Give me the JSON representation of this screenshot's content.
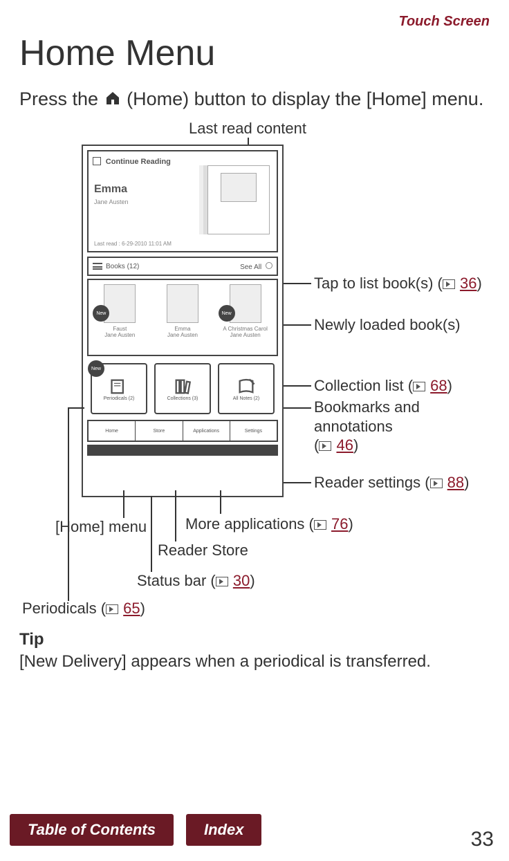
{
  "header": {
    "section": "Touch Screen"
  },
  "title": "Home Menu",
  "intro": {
    "prefix": "Press the ",
    "suffix": " (Home) button to display the [Home] menu."
  },
  "screenshot": {
    "continue_label": "Continue Reading",
    "book_title": "Emma",
    "book_author": "Jane Austen",
    "last_read": "Last read : 6-29-2010 11:01 AM",
    "books_bar_left": "Books (12)",
    "books_bar_right": "See All",
    "new_badge": "New",
    "shelf": [
      {
        "title": "Faust",
        "author": "Jane Austen"
      },
      {
        "title": "Emma",
        "author": "Jane Austen"
      },
      {
        "title": "A Christmas Carol",
        "author": "Jane Austen"
      }
    ],
    "tiles": {
      "periodicals": "Periodicals (2)",
      "collections": "Collections (3)",
      "all_notes": "All Notes (2)"
    },
    "tabs": {
      "home": "Home",
      "store": "Store",
      "apps": "Applications",
      "settings": "Settings"
    }
  },
  "callouts": {
    "last_read": "Last read content",
    "tap_list_prefix": "Tap to list book(s) (",
    "tap_list_page": "36",
    "tap_list_suffix": ")",
    "newly_loaded": "Newly loaded book(s)",
    "collection_prefix": "Collection list (",
    "collection_page": "68",
    "collection_suffix": ")",
    "bookmarks_line1": "Bookmarks and annotations",
    "bookmarks_prefix": "(",
    "bookmarks_page": "46",
    "bookmarks_suffix": ")",
    "settings_prefix": "Reader settings (",
    "settings_page": "88",
    "settings_suffix": ")",
    "more_apps_prefix": "More applications (",
    "more_apps_page": "76",
    "more_apps_suffix": ")",
    "home_menu": "[Home] menu",
    "reader_store": "Reader Store",
    "status_prefix": "Status bar (",
    "status_page": "30",
    "status_suffix": ")",
    "periodicals_prefix": "Periodicals (",
    "periodicals_page": "65",
    "periodicals_suffix": ")"
  },
  "tip": {
    "heading": "Tip",
    "body": "[New Delivery] appears when a periodical is transferred."
  },
  "footer": {
    "toc": "Table of Contents",
    "index": "Index",
    "page": "33"
  }
}
